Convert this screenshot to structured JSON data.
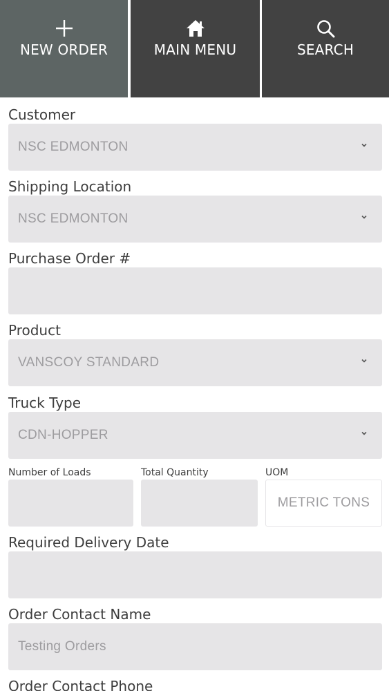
{
  "nav": {
    "new_order": "NEW ORDER",
    "main_menu": "MAIN MENU",
    "search": "SEARCH"
  },
  "form": {
    "customer": {
      "label": "Customer",
      "value": "NSC EDMONTON"
    },
    "shipping_location": {
      "label": "Shipping Location",
      "value": "NSC EDMONTON"
    },
    "purchase_order": {
      "label": "Purchase Order #",
      "value": ""
    },
    "product": {
      "label": "Product",
      "value": "VANSCOY STANDARD"
    },
    "truck_type": {
      "label": "Truck Type",
      "value": "CDN-HOPPER"
    },
    "number_of_loads": {
      "label": "Number of Loads",
      "value": ""
    },
    "total_quantity": {
      "label": "Total Quantity",
      "value": ""
    },
    "uom": {
      "label": "UOM",
      "value": "METRIC TONS"
    },
    "required_delivery_date": {
      "label": "Required Delivery Date",
      "value": ""
    },
    "order_contact_name": {
      "label": "Order Contact Name",
      "placeholder": "Testing Orders"
    },
    "order_contact_phone": {
      "label": "Order Contact Phone"
    }
  },
  "colors": {
    "nav_active": "#5d6564",
    "nav_inactive": "#424242",
    "field_bg": "#e6e5e7",
    "field_text": "#9d9c9f"
  }
}
